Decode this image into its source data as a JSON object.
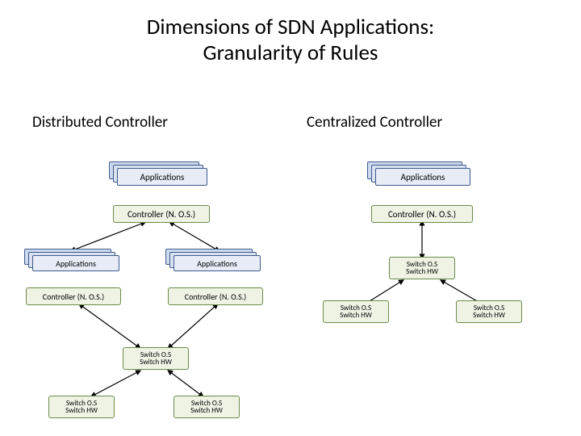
{
  "title_line1": "Dimensions of SDN Applications:",
  "title_line2": "Granularity of Rules",
  "left": {
    "heading": "Distributed Controller",
    "top_apps": "Applications",
    "top_ctrl": "Controller (N. O.S.)",
    "apps_a": "Applications",
    "apps_b": "Applications",
    "ctrl_a": "Controller (N. O.S.)",
    "ctrl_b": "Controller (N. O.S.)",
    "sw_top_l1": "Switch O.S",
    "sw_top_l2": "Switch HW",
    "sw_bl_l1": "Switch O.S",
    "sw_bl_l2": "Switch HW",
    "sw_br_l1": "Switch O.S",
    "sw_br_l2": "Switch HW"
  },
  "right": {
    "heading": "Centralized Controller",
    "apps": "Applications",
    "ctrl": "Controller (N. O.S.)",
    "sw_top_l1": "Switch O.S",
    "sw_top_l2": "Switch HW",
    "sw_bl_l1": "Switch O.S",
    "sw_bl_l2": "Switch HW",
    "sw_br_l1": "Switch O.S",
    "sw_br_l2": "Switch HW"
  }
}
